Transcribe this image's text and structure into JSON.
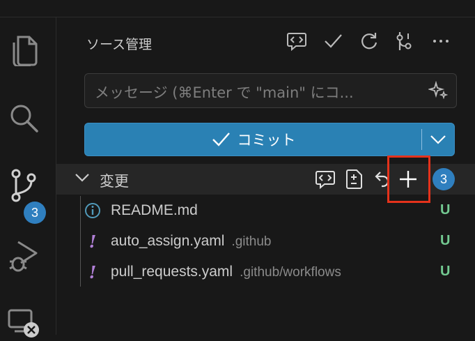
{
  "activity_bar": {
    "scm_badge": "3",
    "icons": [
      "explorer-icon",
      "search-icon",
      "source-control-icon",
      "run-debug-icon",
      "remote-explorer-icon"
    ]
  },
  "panel": {
    "title": "ソース管理",
    "toolbar_icons": [
      "generate-commit-message-icon",
      "commit-check-icon",
      "refresh-icon",
      "graph-icon",
      "more-icon"
    ]
  },
  "message_input": {
    "placeholder": "メッセージ (⌘Enter で \"main\" にコ..."
  },
  "commit_button": {
    "label": "コミット"
  },
  "changes_group": {
    "label": "変更",
    "count": "3"
  },
  "files": [
    {
      "name": "README.md",
      "path": "",
      "status": "U",
      "icon": "info-icon"
    },
    {
      "name": "auto_assign.yaml",
      "path": ".github",
      "status": "U",
      "icon": "yaml-icon"
    },
    {
      "name": "pull_requests.yaml",
      "path": ".github/workflows",
      "status": "U",
      "icon": "yaml-icon"
    }
  ],
  "colors": {
    "accent": "#2a81b4",
    "badge": "#2f7fbf",
    "untracked": "#73c991",
    "highlight": "#e5321b",
    "yaml": "#b180d7"
  }
}
